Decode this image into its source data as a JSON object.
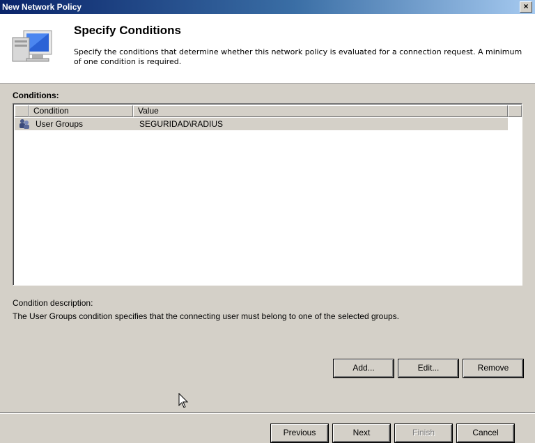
{
  "window": {
    "title": "New Network Policy",
    "close_glyph": "×"
  },
  "header": {
    "title": "Specify Conditions",
    "description": "Specify the conditions that determine whether this network policy is evaluated for a connection request. A minimum of one condition is required.",
    "icon": "monitor-icon"
  },
  "conditions": {
    "label": "Conditions:",
    "columns": [
      "Condition",
      "Value"
    ],
    "rows": [
      {
        "icon": "user-group-icon",
        "condition": "User Groups",
        "value": "SEGURIDAD\\RADIUS"
      }
    ]
  },
  "description_section": {
    "label": "Condition description:",
    "text": "The User Groups condition specifies that the connecting user must belong to one of the selected groups."
  },
  "action_buttons": {
    "add": "Add...",
    "edit": "Edit...",
    "remove": "Remove"
  },
  "nav_buttons": {
    "previous": "Previous",
    "next": "Next",
    "finish": "Finish",
    "cancel": "Cancel"
  },
  "colors": {
    "titlebar_start": "#0a246a",
    "titlebar_end": "#a6caf0",
    "dialog_bg": "#d4d0c8",
    "selected_row": "#d4d0c8"
  }
}
